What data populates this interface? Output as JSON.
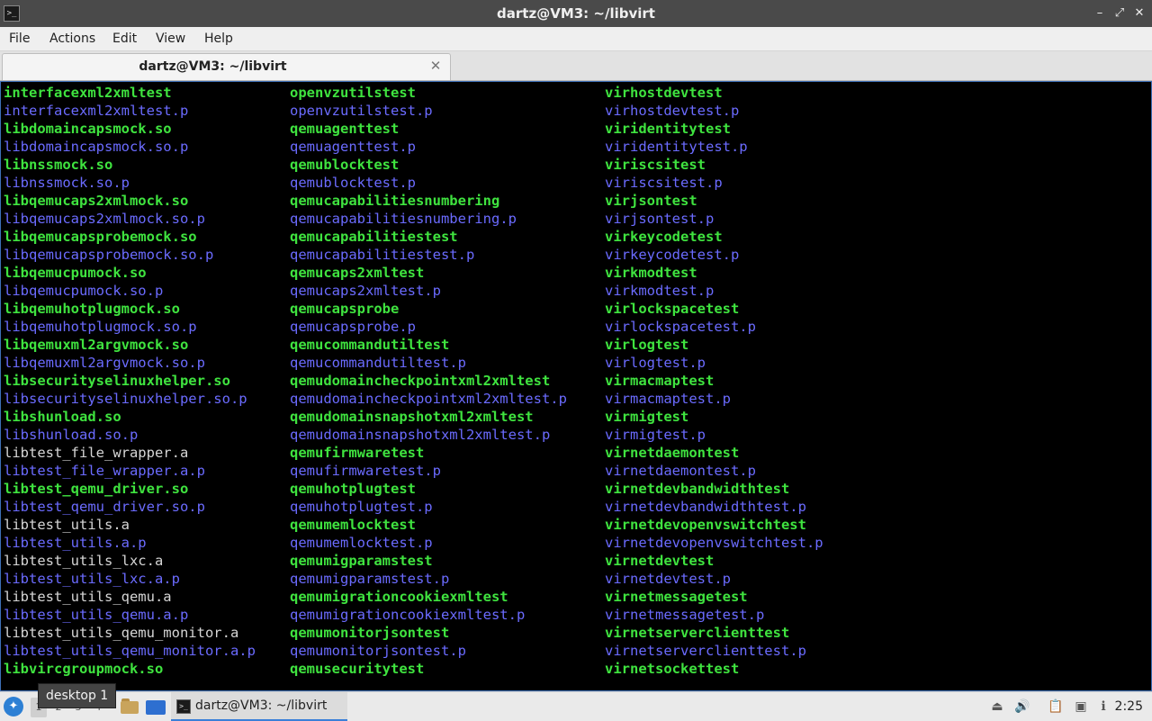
{
  "window": {
    "title": "dartz@VM3: ~/libvirt",
    "icon": "terminal-icon"
  },
  "menu": {
    "items": [
      "File",
      "Actions",
      "Edit",
      "View",
      "Help"
    ]
  },
  "tabs": [
    {
      "label": "dartz@VM3: ~/libvirt",
      "close_icon": "close-icon"
    }
  ],
  "terminal": {
    "columns": [
      [
        {
          "t": "interfacexml2xmltest",
          "c": "exe"
        },
        {
          "t": "interfacexml2xmltest.p",
          "c": "pdir"
        },
        {
          "t": "libdomaincapsmock.so",
          "c": "exe"
        },
        {
          "t": "libdomaincapsmock.so.p",
          "c": "pdir"
        },
        {
          "t": "libnssmock.so",
          "c": "exe"
        },
        {
          "t": "libnssmock.so.p",
          "c": "pdir"
        },
        {
          "t": "libqemucaps2xmlmock.so",
          "c": "exe"
        },
        {
          "t": "libqemucaps2xmlmock.so.p",
          "c": "pdir"
        },
        {
          "t": "libqemucapsprobemock.so",
          "c": "exe"
        },
        {
          "t": "libqemucapsprobemock.so.p",
          "c": "pdir"
        },
        {
          "t": "libqemucpumock.so",
          "c": "exe"
        },
        {
          "t": "libqemucpumock.so.p",
          "c": "pdir"
        },
        {
          "t": "libqemuhotplugmock.so",
          "c": "exe"
        },
        {
          "t": "libqemuhotplugmock.so.p",
          "c": "pdir"
        },
        {
          "t": "libqemuxml2argvmock.so",
          "c": "exe"
        },
        {
          "t": "libqemuxml2argvmock.so.p",
          "c": "pdir"
        },
        {
          "t": "libsecurityselinuxhelper.so",
          "c": "exe"
        },
        {
          "t": "libsecurityselinuxhelper.so.p",
          "c": "pdir"
        },
        {
          "t": "libshunload.so",
          "c": "exe"
        },
        {
          "t": "libshunload.so.p",
          "c": "pdir"
        },
        {
          "t": "libtest_file_wrapper.a",
          "c": "plain"
        },
        {
          "t": "libtest_file_wrapper.a.p",
          "c": "pdir"
        },
        {
          "t": "libtest_qemu_driver.so",
          "c": "exe"
        },
        {
          "t": "libtest_qemu_driver.so.p",
          "c": "pdir"
        },
        {
          "t": "libtest_utils.a",
          "c": "plain"
        },
        {
          "t": "libtest_utils.a.p",
          "c": "pdir"
        },
        {
          "t": "libtest_utils_lxc.a",
          "c": "plain"
        },
        {
          "t": "libtest_utils_lxc.a.p",
          "c": "pdir"
        },
        {
          "t": "libtest_utils_qemu.a",
          "c": "plain"
        },
        {
          "t": "libtest_utils_qemu.a.p",
          "c": "pdir"
        },
        {
          "t": "libtest_utils_qemu_monitor.a",
          "c": "plain"
        },
        {
          "t": "libtest_utils_qemu_monitor.a.p",
          "c": "pdir"
        },
        {
          "t": "libvircgroupmock.so",
          "c": "exe"
        }
      ],
      [
        {
          "t": "openvzutilstest",
          "c": "exe"
        },
        {
          "t": "openvzutilstest.p",
          "c": "pdir"
        },
        {
          "t": "qemuagenttest",
          "c": "exe"
        },
        {
          "t": "qemuagenttest.p",
          "c": "pdir"
        },
        {
          "t": "qemublocktest",
          "c": "exe"
        },
        {
          "t": "qemublocktest.p",
          "c": "pdir"
        },
        {
          "t": "qemucapabilitiesnumbering",
          "c": "exe"
        },
        {
          "t": "qemucapabilitiesnumbering.p",
          "c": "pdir"
        },
        {
          "t": "qemucapabilitiestest",
          "c": "exe"
        },
        {
          "t": "qemucapabilitiestest.p",
          "c": "pdir"
        },
        {
          "t": "qemucaps2xmltest",
          "c": "exe"
        },
        {
          "t": "qemucaps2xmltest.p",
          "c": "pdir"
        },
        {
          "t": "qemucapsprobe",
          "c": "exe"
        },
        {
          "t": "qemucapsprobe.p",
          "c": "pdir"
        },
        {
          "t": "qemucommandutiltest",
          "c": "exe"
        },
        {
          "t": "qemucommandutiltest.p",
          "c": "pdir"
        },
        {
          "t": "qemudomaincheckpointxml2xmltest",
          "c": "exe"
        },
        {
          "t": "qemudomaincheckpointxml2xmltest.p",
          "c": "pdir"
        },
        {
          "t": "qemudomainsnapshotxml2xmltest",
          "c": "exe"
        },
        {
          "t": "qemudomainsnapshotxml2xmltest.p",
          "c": "pdir"
        },
        {
          "t": "qemufirmwaretest",
          "c": "exe"
        },
        {
          "t": "qemufirmwaretest.p",
          "c": "pdir"
        },
        {
          "t": "qemuhotplugtest",
          "c": "exe"
        },
        {
          "t": "qemuhotplugtest.p",
          "c": "pdir"
        },
        {
          "t": "qemumemlocktest",
          "c": "exe"
        },
        {
          "t": "qemumemlocktest.p",
          "c": "pdir"
        },
        {
          "t": "qemumigparamstest",
          "c": "exe"
        },
        {
          "t": "qemumigparamstest.p",
          "c": "pdir"
        },
        {
          "t": "qemumigrationcookiexmltest",
          "c": "exe"
        },
        {
          "t": "qemumigrationcookiexmltest.p",
          "c": "pdir"
        },
        {
          "t": "qemumonitorjsontest",
          "c": "exe"
        },
        {
          "t": "qemumonitorjsontest.p",
          "c": "pdir"
        },
        {
          "t": "qemusecuritytest",
          "c": "exe"
        }
      ],
      [
        {
          "t": "virhostdevtest",
          "c": "exe"
        },
        {
          "t": "virhostdevtest.p",
          "c": "pdir"
        },
        {
          "t": "viridentitytest",
          "c": "exe"
        },
        {
          "t": "viridentitytest.p",
          "c": "pdir"
        },
        {
          "t": "viriscsitest",
          "c": "exe"
        },
        {
          "t": "viriscsitest.p",
          "c": "pdir"
        },
        {
          "t": "virjsontest",
          "c": "exe"
        },
        {
          "t": "virjsontest.p",
          "c": "pdir"
        },
        {
          "t": "virkeycodetest",
          "c": "exe"
        },
        {
          "t": "virkeycodetest.p",
          "c": "pdir"
        },
        {
          "t": "virkmodtest",
          "c": "exe"
        },
        {
          "t": "virkmodtest.p",
          "c": "pdir"
        },
        {
          "t": "virlockspacetest",
          "c": "exe"
        },
        {
          "t": "virlockspacetest.p",
          "c": "pdir"
        },
        {
          "t": "virlogtest",
          "c": "exe"
        },
        {
          "t": "virlogtest.p",
          "c": "pdir"
        },
        {
          "t": "virmacmaptest",
          "c": "exe"
        },
        {
          "t": "virmacmaptest.p",
          "c": "pdir"
        },
        {
          "t": "virmigtest",
          "c": "exe"
        },
        {
          "t": "virmigtest.p",
          "c": "pdir"
        },
        {
          "t": "virnetdaemontest",
          "c": "exe"
        },
        {
          "t": "virnetdaemontest.p",
          "c": "pdir"
        },
        {
          "t": "virnetdevbandwidthtest",
          "c": "exe"
        },
        {
          "t": "virnetdevbandwidthtest.p",
          "c": "pdir"
        },
        {
          "t": "virnetdevopenvswitchtest",
          "c": "exe"
        },
        {
          "t": "virnetdevopenvswitchtest.p",
          "c": "pdir"
        },
        {
          "t": "virnetdevtest",
          "c": "exe"
        },
        {
          "t": "virnetdevtest.p",
          "c": "pdir"
        },
        {
          "t": "virnetmessagetest",
          "c": "exe"
        },
        {
          "t": "virnetmessagetest.p",
          "c": "pdir"
        },
        {
          "t": "virnetserverclienttest",
          "c": "exe"
        },
        {
          "t": "virnetserverclienttest.p",
          "c": "pdir"
        },
        {
          "t": "virnetsockettest",
          "c": "exe"
        }
      ]
    ],
    "colors": {
      "executable": "#3fe33f",
      "directory": "#6b6bff",
      "plain": "#d6d6d6",
      "background": "#000000"
    }
  },
  "taskbar": {
    "start_icon": "start-menu-icon",
    "desktops": [
      "1",
      "2",
      "3",
      "4"
    ],
    "tooltip": "desktop 1",
    "launchers": [
      "file-manager-icon",
      "web-browser-icon"
    ],
    "task": {
      "label": "dartz@VM3: ~/libvirt",
      "icon": "terminal-icon"
    },
    "tray": [
      "removable-media-icon",
      "volume-icon",
      "clipboard-icon",
      "display-icon",
      "notification-icon"
    ],
    "clock": "2:25"
  }
}
